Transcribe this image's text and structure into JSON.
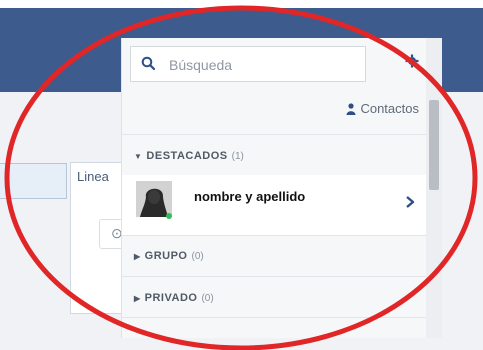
{
  "search": {
    "placeholder": "Búsqueda"
  },
  "contacts_link": {
    "label": "Contactos",
    "icon": "person-icon"
  },
  "sections": [
    {
      "label": "DESTACADOS",
      "count": "(1)",
      "expanded": true
    },
    {
      "label": "GRUPO",
      "count": "(0)",
      "expanded": false
    },
    {
      "label": "PRIVADO",
      "count": "(0)",
      "expanded": false
    }
  ],
  "contact": {
    "name": "nombre y apellido",
    "status": "online"
  },
  "background": {
    "card_title": "Linea"
  },
  "colors": {
    "topbar": "#3e5b8e",
    "accent_text": "#2e4f85",
    "online": "#2ebd5a",
    "annotation": "#e02626"
  }
}
